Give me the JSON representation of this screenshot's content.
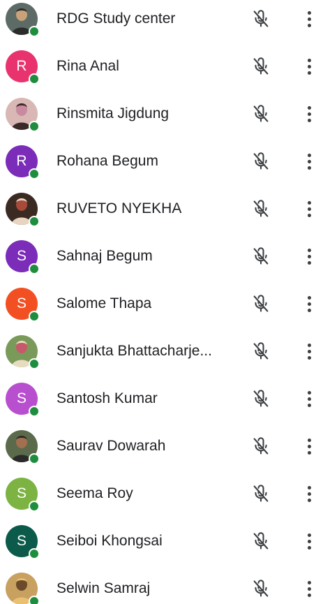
{
  "participants": [
    {
      "name": "RDG Study center",
      "avatar": {
        "type": "photo",
        "colors": [
          "#5d6b66",
          "#c9a27a",
          "#2b2b2b"
        ]
      },
      "muted": true
    },
    {
      "name": "Rina Anal",
      "avatar": {
        "type": "letter",
        "letter": "R",
        "color": "#e8336e"
      },
      "muted": true
    },
    {
      "name": "Rinsmita Jigdung",
      "avatar": {
        "type": "photo",
        "colors": [
          "#d8b7b4",
          "#c98aa0",
          "#3b2a2a"
        ]
      },
      "muted": true
    },
    {
      "name": "Rohana Begum",
      "avatar": {
        "type": "letter",
        "letter": "R",
        "color": "#7b2cb8"
      },
      "muted": true
    },
    {
      "name": "RUVETO NYEKHA",
      "avatar": {
        "type": "photo",
        "colors": [
          "#3a2a22",
          "#a84a3a",
          "#e8d4c0"
        ]
      },
      "muted": true
    },
    {
      "name": "Sahnaj Begum",
      "avatar": {
        "type": "letter",
        "letter": "S",
        "color": "#7b2cb8"
      },
      "muted": true
    },
    {
      "name": "Salome Thapa",
      "avatar": {
        "type": "letter",
        "letter": "S",
        "color": "#f25022"
      },
      "muted": true
    },
    {
      "name": "Sanjukta Bhattacharje...",
      "avatar": {
        "type": "photo",
        "colors": [
          "#7a9a5a",
          "#c65a6a",
          "#e8dcc0"
        ]
      },
      "muted": true
    },
    {
      "name": "Santosh Kumar",
      "avatar": {
        "type": "letter",
        "letter": "S",
        "color": "#b84fcf"
      },
      "muted": true
    },
    {
      "name": "Saurav Dowarah",
      "avatar": {
        "type": "photo",
        "colors": [
          "#5a6a4a",
          "#a07050",
          "#2a2a2a"
        ]
      },
      "muted": true
    },
    {
      "name": "Seema Roy",
      "avatar": {
        "type": "letter",
        "letter": "S",
        "color": "#7cb342"
      },
      "muted": true
    },
    {
      "name": "Seiboi Khongsai",
      "avatar": {
        "type": "letter",
        "letter": "S",
        "color": "#0b5a4a"
      },
      "muted": true
    },
    {
      "name": "Selwin Samraj",
      "avatar": {
        "type": "photo",
        "colors": [
          "#c8a060",
          "#6a4a2a",
          "#e8c070"
        ]
      },
      "muted": true
    }
  ],
  "icons": {
    "mic": "mic-off-icon",
    "more": "more-vert-icon",
    "status": "online-status-dot"
  },
  "theme": {
    "online": "#1e8e3e",
    "icon": "#3c4043",
    "text": "#202124"
  }
}
